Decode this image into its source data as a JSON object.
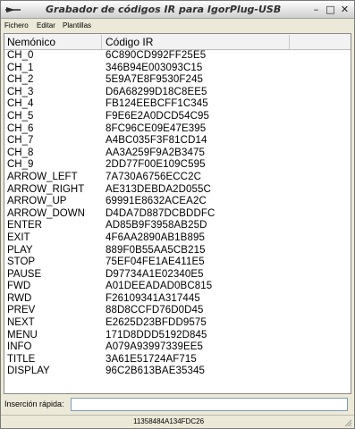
{
  "window": {
    "title": "Grabador de códigos IR para IgorPlug-USB",
    "controls": {
      "minimize": "–",
      "maximize": "□",
      "close": "✕"
    }
  },
  "menu": [
    "Fichero",
    "Editar",
    "Plantillas"
  ],
  "table": {
    "columns": [
      "Nemónico",
      "Código IR"
    ],
    "rows": [
      [
        "CH_0",
        "6C890CD992FF25E5"
      ],
      [
        "CH_1",
        "346B94E003093C15"
      ],
      [
        "CH_2",
        "5E9A7E8F9530F245"
      ],
      [
        "CH_3",
        "D6A68299D18C8EE5"
      ],
      [
        "CH_4",
        "FB124EEBCFF1C345"
      ],
      [
        "CH_5",
        "F9E6E2A0DCD54C95"
      ],
      [
        "CH_6",
        "8FC96CE09E47E395"
      ],
      [
        "CH_7",
        "A4BC035F3F81CD14"
      ],
      [
        "CH_8",
        "AA3A259F9A2B3475"
      ],
      [
        "CH_9",
        "2DD77F00E109C595"
      ],
      [
        "ARROW_LEFT",
        "7A730A6756ECC2C"
      ],
      [
        "ARROW_RIGHT",
        "AE313DEBDA2D055C"
      ],
      [
        "ARROW_UP",
        "69991E8632ACEA2C"
      ],
      [
        "ARROW_DOWN",
        "D4DA7D887DCBDDFC"
      ],
      [
        "ENTER",
        "AD85B9F3958AB25D"
      ],
      [
        "EXIT",
        "4F6AA2890AB1B895"
      ],
      [
        "PLAY",
        "889F0B55AA5CB215"
      ],
      [
        "STOP",
        "75EF04FE1AE411E5"
      ],
      [
        "PAUSE",
        "D97734A1E02340E5"
      ],
      [
        "FWD",
        "A01DEEADAD0BC815"
      ],
      [
        "RWD",
        "F26109341A317445"
      ],
      [
        "PREV",
        "88D8CCFD76D0D45"
      ],
      [
        "NEXT",
        "E2625D23BFDD9575"
      ],
      [
        "MENU",
        "171D8DDD5192D845"
      ],
      [
        "INFO",
        "A079A93997339EE5"
      ],
      [
        "TITLE",
        "3A61E51724AF715"
      ],
      [
        "DISPLAY",
        "96C2B613BAE35345"
      ]
    ]
  },
  "quick_insert": {
    "label": "Inserción rápida:",
    "value": ""
  },
  "status": {
    "text": "11358484A134FDC26"
  }
}
